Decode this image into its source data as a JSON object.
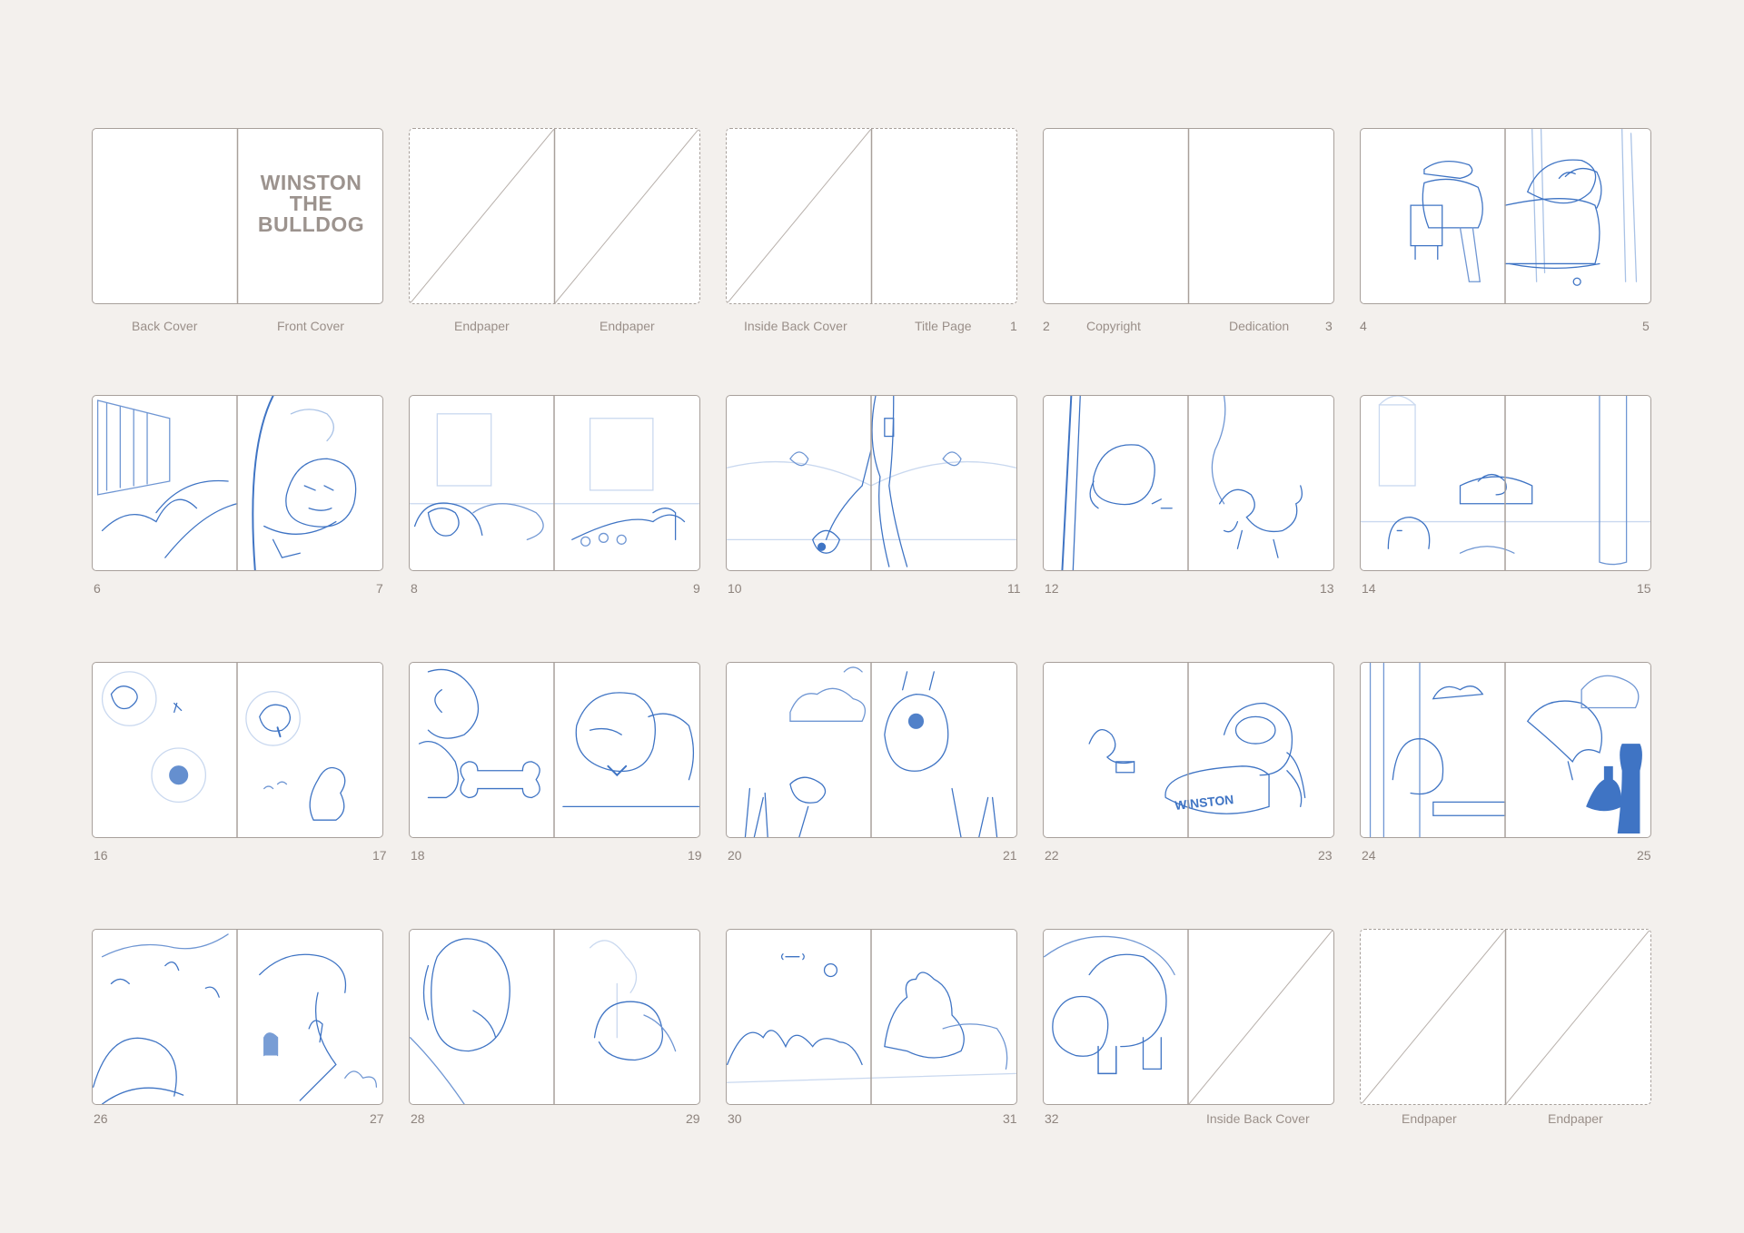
{
  "colors": {
    "background": "#f3f0ed",
    "frame": "#a8a09b",
    "sketch": "#3f74c4",
    "sketch_light": "#a9c2e6",
    "label": "#9a8f89"
  },
  "cover": {
    "title_line1": "WINSTON",
    "title_line2": "THE",
    "title_line3": "BULLDOG"
  },
  "spreads": [
    {
      "left_label": "Back Cover",
      "right_label": "Front Cover",
      "left_num": "",
      "right_num": ""
    },
    {
      "left_label": "Endpaper",
      "right_label": "Endpaper",
      "left_num": "",
      "right_num": ""
    },
    {
      "left_label": "Inside Back Cover",
      "right_label": "Title Page",
      "left_num": "",
      "right_num": "1"
    },
    {
      "left_label": "Copyright",
      "right_label": "Dedication",
      "left_num": "2",
      "right_num": "3"
    },
    {
      "left_label": "",
      "right_label": "",
      "left_num": "4",
      "right_num": "5"
    },
    {
      "left_label": "",
      "right_label": "",
      "left_num": "6",
      "right_num": "7"
    },
    {
      "left_label": "",
      "right_label": "",
      "left_num": "8",
      "right_num": "9"
    },
    {
      "left_label": "",
      "right_label": "",
      "left_num": "10",
      "right_num": "11"
    },
    {
      "left_label": "",
      "right_label": "",
      "left_num": "12",
      "right_num": "13"
    },
    {
      "left_label": "",
      "right_label": "",
      "left_num": "14",
      "right_num": "15"
    },
    {
      "left_label": "",
      "right_label": "",
      "left_num": "16",
      "right_num": "17"
    },
    {
      "left_label": "",
      "right_label": "",
      "left_num": "18",
      "right_num": "19"
    },
    {
      "left_label": "",
      "right_label": "",
      "left_num": "20",
      "right_num": "21"
    },
    {
      "left_label": "",
      "right_label": "",
      "left_num": "22",
      "right_num": "23"
    },
    {
      "left_label": "",
      "right_label": "",
      "left_num": "24",
      "right_num": "25"
    },
    {
      "left_label": "",
      "right_label": "",
      "left_num": "26",
      "right_num": "27"
    },
    {
      "left_label": "",
      "right_label": "",
      "left_num": "28",
      "right_num": "29"
    },
    {
      "left_label": "",
      "right_label": "",
      "left_num": "30",
      "right_num": "31"
    },
    {
      "left_label": "",
      "right_label": "Inside Back Cover",
      "left_num": "32",
      "right_num": ""
    },
    {
      "left_label": "Endpaper",
      "right_label": "Endpaper",
      "left_num": "",
      "right_num": ""
    }
  ],
  "bowl_text": "WINSTON"
}
